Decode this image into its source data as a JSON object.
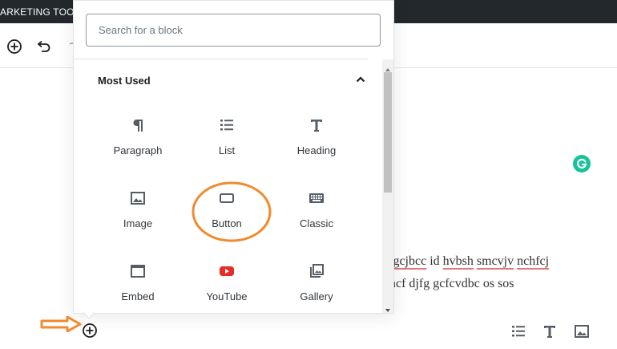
{
  "admin_bar": {
    "text": "ARKETING TOO"
  },
  "inserter": {
    "search": {
      "placeholder": "Search for a block"
    },
    "panel": {
      "title": "Most Used"
    },
    "blocks": [
      {
        "label": "Paragraph",
        "icon": "paragraph-icon"
      },
      {
        "label": "List",
        "icon": "list-icon"
      },
      {
        "label": "Heading",
        "icon": "heading-icon"
      },
      {
        "label": "Image",
        "icon": "image-icon"
      },
      {
        "label": "Button",
        "icon": "button-icon"
      },
      {
        "label": "Classic",
        "icon": "keyboard-icon"
      },
      {
        "label": "Embed",
        "icon": "embed-icon"
      },
      {
        "label": "YouTube",
        "icon": "youtube-icon"
      },
      {
        "label": "Gallery",
        "icon": "gallery-icon"
      }
    ]
  },
  "content": {
    "line1_words": [
      "jgcjbcc",
      " id ",
      "hvbsh",
      " ",
      "smcvjv",
      " ",
      "nchfcj"
    ],
    "line2": "ncf djfg gcfcvdbc os sos"
  },
  "colors": {
    "admin_bar": "#23282d",
    "annotation": "#f28a2e",
    "youtube": "#e52d27",
    "grammarly": "#15c39a",
    "spell_underline": "#e0777c"
  }
}
